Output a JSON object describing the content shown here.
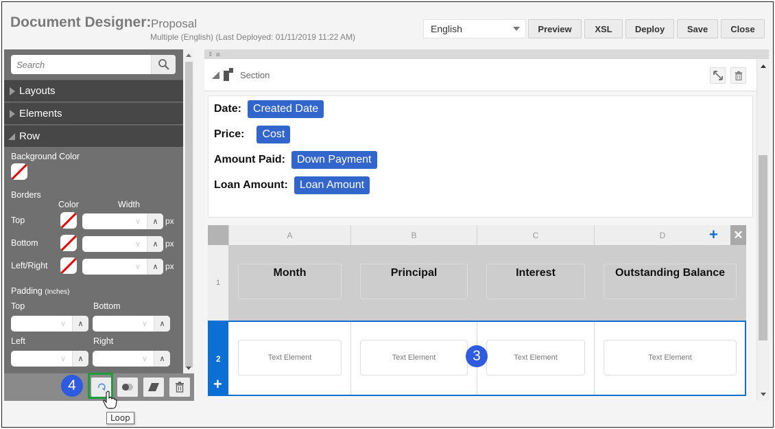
{
  "header": {
    "app_title": "Document Designer:",
    "document_name": "Proposal",
    "subtitle": "Multiple (English)  (Last Deployed: 01/11/2019 11:22 AM)",
    "language": "English",
    "buttons": {
      "preview": "Preview",
      "xsl": "XSL",
      "deploy": "Deploy",
      "save": "Save",
      "close": "Close"
    }
  },
  "sidebar": {
    "search_placeholder": "Search",
    "accordions": [
      {
        "label": "Layouts",
        "expanded": false
      },
      {
        "label": "Elements",
        "expanded": false
      },
      {
        "label": "Row",
        "expanded": true
      }
    ],
    "row_props": {
      "background_color_label": "Background Color",
      "borders_label": "Borders",
      "color_col": "Color",
      "width_col": "Width",
      "border_rows": [
        {
          "label": "Top",
          "unit": "px",
          "value": ""
        },
        {
          "label": "Bottom",
          "unit": "px",
          "value": ""
        },
        {
          "label": "Left/Right",
          "unit": "px",
          "value": ""
        }
      ],
      "padding_label": "Padding",
      "padding_unit": "(Inches)",
      "padding_fields": [
        {
          "label": "Top",
          "value": ""
        },
        {
          "label": "Bottom",
          "value": ""
        },
        {
          "label": "Left",
          "value": ""
        },
        {
          "label": "Right",
          "value": ""
        }
      ]
    },
    "footer_tools": [
      "loop-icon",
      "toggle-icon",
      "eraser-icon",
      "trash-icon"
    ],
    "tooltip": "Loop",
    "callout_badge": "4"
  },
  "canvas": {
    "section_label": "Section",
    "fields": [
      {
        "label": "Date:",
        "token": "Created Date"
      },
      {
        "label": "Price:",
        "token": "Cost"
      },
      {
        "label": "Amount Paid:",
        "token": "Down Payment"
      },
      {
        "label": "Loan Amount:",
        "token": "Loan Amount"
      }
    ],
    "table": {
      "columns": [
        "A",
        "B",
        "C",
        "D"
      ],
      "rows": [
        {
          "number": "1",
          "cells": [
            "Month",
            "Principal",
            "Interest",
            "Outstanding Balance"
          ]
        },
        {
          "number": "2",
          "cells": [
            "Text Element",
            "Text Element",
            "Text Element",
            "Text Element"
          ]
        }
      ]
    },
    "callout_badge": "3"
  },
  "colors": {
    "token_blue": "#3366cc",
    "selected_row_blue": "#0b6fd3",
    "highlight_green": "#1e9e3a",
    "callout_badge": "#2f5be0"
  }
}
